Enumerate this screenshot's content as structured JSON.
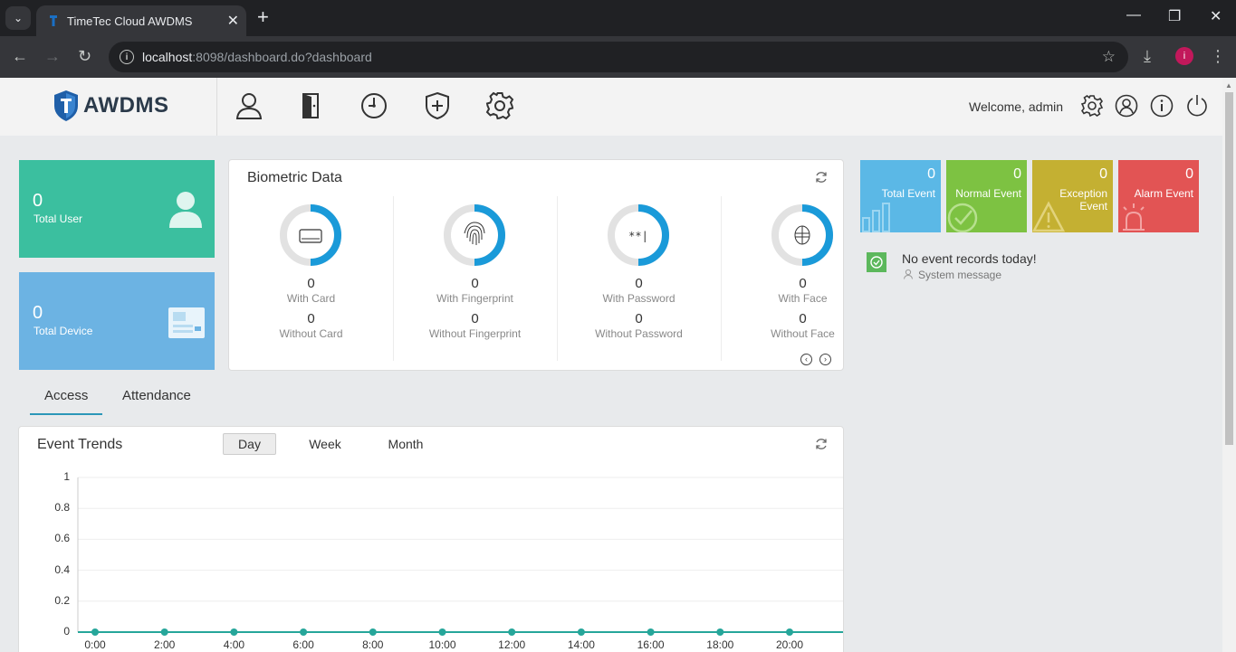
{
  "browser": {
    "tab_title": "TimeTec Cloud AWDMS",
    "url_host": "localhost",
    "url_path": ":8098/dashboard.do?dashboard",
    "profile_initial": "i"
  },
  "header": {
    "logo_text": "AWDMS",
    "nav_icons": [
      "user-icon",
      "door-icon",
      "clock-icon",
      "shield-plus-icon",
      "gear-icon"
    ],
    "welcome": "Welcome, admin"
  },
  "stats": {
    "total_user": {
      "value": "0",
      "label": "Total User",
      "color": "#3bbf9f"
    },
    "total_device": {
      "value": "0",
      "label": "Total Device",
      "color": "#6cb3e3"
    }
  },
  "biometric": {
    "title": "Biometric Data",
    "columns": [
      {
        "value_with": "0",
        "label_with": "With Card",
        "value_without": "0",
        "label_without": "Without Card",
        "icon": "card-icon"
      },
      {
        "value_with": "0",
        "label_with": "With Fingerprint",
        "value_without": "0",
        "label_without": "Without Fingerprint",
        "icon": "fingerprint-icon"
      },
      {
        "value_with": "0",
        "label_with": "With Password",
        "value_without": "0",
        "label_without": "Without Password",
        "icon_text": "**|"
      },
      {
        "value_with": "0",
        "label_with": "With Face",
        "value_without": "0",
        "label_without": "Without Face",
        "icon": "face-icon"
      }
    ]
  },
  "events": {
    "tiles": [
      {
        "value": "0",
        "label": "Total Event",
        "color": "#5bb8e6"
      },
      {
        "value": "0",
        "label": "Normal Event",
        "color": "#7dc242"
      },
      {
        "value": "0",
        "label": "Exception Event",
        "color": "#c4b032"
      },
      {
        "value": "0",
        "label": "Alarm Event",
        "color": "#e25454"
      }
    ],
    "message_title": "No event records today!",
    "message_sub": "System message"
  },
  "tabs": [
    "Access",
    "Attendance"
  ],
  "trends": {
    "title": "Event Trends",
    "periods": [
      "Day",
      "Week",
      "Month"
    ],
    "active_period": "Day"
  },
  "chart_data": {
    "type": "line",
    "x": [
      "0:00",
      "2:00",
      "4:00",
      "6:00",
      "8:00",
      "10:00",
      "12:00",
      "14:00",
      "16:00",
      "18:00",
      "20:00"
    ],
    "series": [
      {
        "values": [
          0,
          0,
          0,
          0,
          0,
          0,
          0,
          0,
          0,
          0,
          0
        ],
        "color": "#26a69a"
      }
    ],
    "ylim": [
      0,
      1
    ],
    "yticks": [
      "1",
      "0.8",
      "0.6",
      "0.4",
      "0.2",
      "0"
    ],
    "grid": true
  }
}
